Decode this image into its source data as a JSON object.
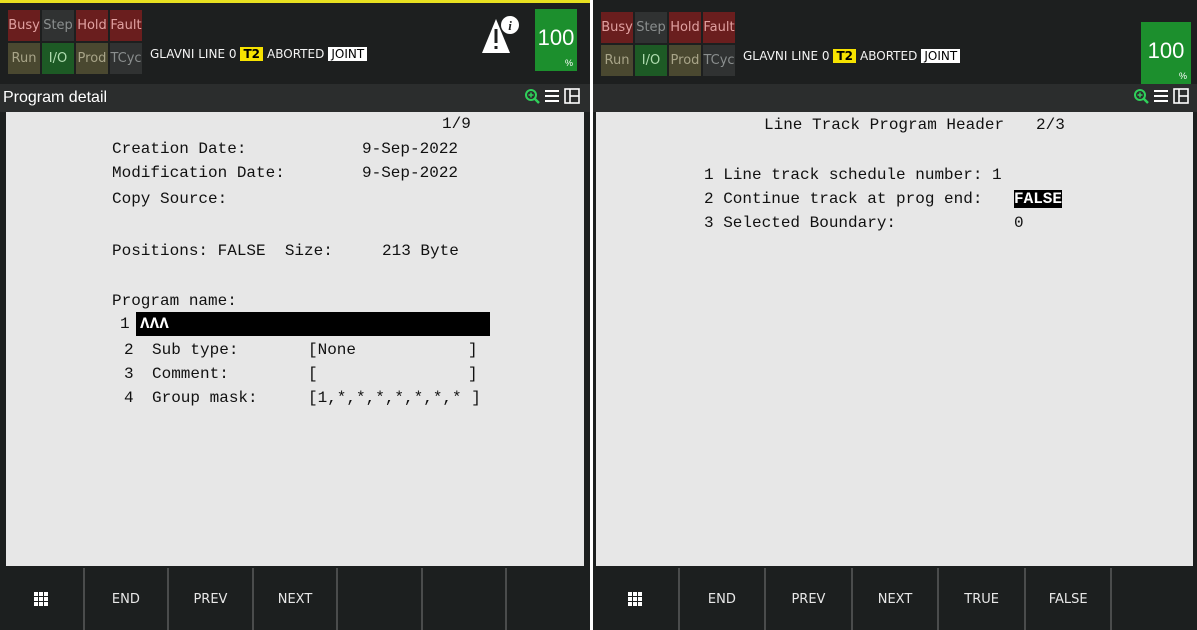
{
  "colors": {
    "speed_green": "#1c8f2d",
    "t2_yellow": "#f6e200",
    "top_accent": "#e8e020"
  },
  "left": {
    "status": {
      "row1": [
        "Busy",
        "Step",
        "Hold",
        "Fault"
      ],
      "row2": [
        "Run",
        "I/O",
        "Prod",
        "TCyc"
      ],
      "program": "GLAVNI LINE 0",
      "mode": "T2",
      "state": "ABORTED",
      "coord": "JOINT",
      "speed": "100",
      "speed_unit": "%",
      "alert_icon": "info-warning-icon"
    },
    "title": "Program detail",
    "page": "1/9",
    "creation_label": "Creation Date:",
    "creation_value": "9-Sep-2022",
    "modification_label": "Modification Date:",
    "modification_value": "9-Sep-2022",
    "copy_source_label": "Copy Source:",
    "positions_line": "Positions: FALSE  Size:",
    "size_value": "213 Byte",
    "program_name_label": "Program name:",
    "items": [
      {
        "num": "1",
        "value": "ΛΛΛ"
      },
      {
        "num": "2",
        "label": "Sub type:",
        "value": "[None",
        "close": "]"
      },
      {
        "num": "3",
        "label": "Comment:",
        "value": "[",
        "close": "]"
      },
      {
        "num": "4",
        "label": "Group mask:",
        "value": "[1,*,*,*,*,*,*,* ]"
      }
    ],
    "fkeys": [
      "",
      "END",
      "PREV",
      "NEXT",
      "",
      "",
      ""
    ]
  },
  "right": {
    "status": {
      "row1": [
        "Busy",
        "Step",
        "Hold",
        "Fault"
      ],
      "row2": [
        "Run",
        "I/O",
        "Prod",
        "TCyc"
      ],
      "program": "GLAVNI LINE 0",
      "mode": "T2",
      "state": "ABORTED",
      "coord": "JOINT",
      "speed": "100",
      "speed_unit": "%"
    },
    "heading": "Line Track Program Header",
    "page": "2/3",
    "items": [
      {
        "text": "1 Line track schedule number: 1"
      },
      {
        "text": "2 Continue track at prog end: ",
        "value": "FALSE"
      },
      {
        "text": "3 Selected Boundary:",
        "value": "0"
      }
    ],
    "fkeys": [
      "",
      "END",
      "PREV",
      "NEXT",
      "TRUE",
      "FALSE",
      ""
    ]
  }
}
